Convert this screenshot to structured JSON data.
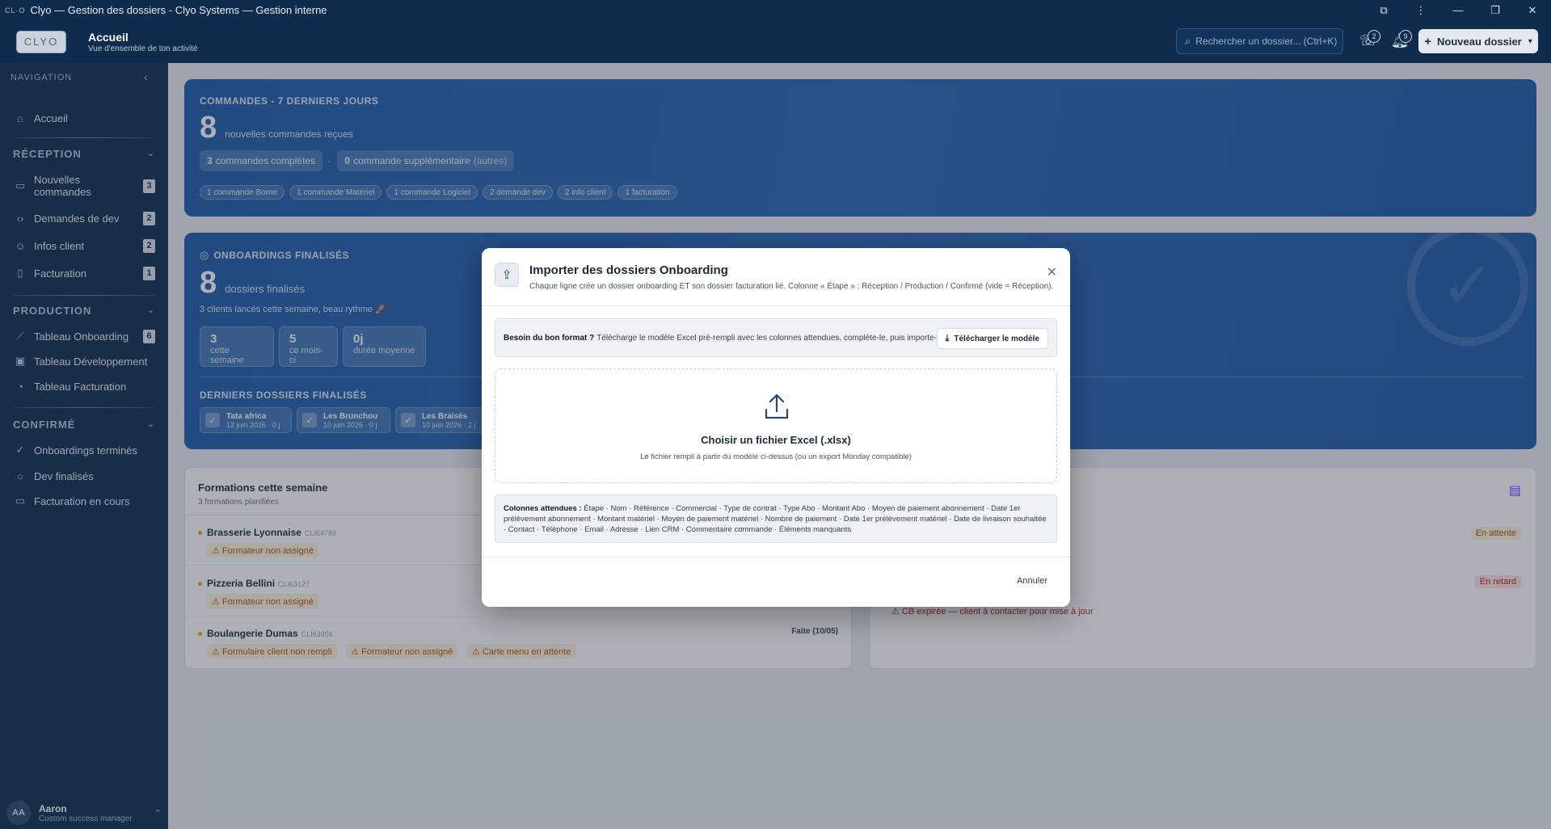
{
  "window": {
    "title": "Clyo — Gestion des dossiers - Clyo Systems — Gestion interne",
    "logo_small": "CL·O"
  },
  "header": {
    "logo": "CLYO",
    "title": "Accueil",
    "subtitle": "Vue d'ensemble de ton activité",
    "search_placeholder": "Rechercher un dossier... (Ctrl+K)",
    "activity_count": "2",
    "notif_count": "9",
    "new_button": "Nouveau dossier"
  },
  "sidebar": {
    "nav_head": "NAVIGATION",
    "home": "Accueil",
    "sections": {
      "reception": "RÉCEPTION",
      "production": "PRODUCTION",
      "confirme": "CONFIRMÉ"
    },
    "reception_items": [
      {
        "label": "Nouvelles commandes",
        "badge": "3"
      },
      {
        "label": "Demandes de dev",
        "badge": "2"
      },
      {
        "label": "Infos client",
        "badge": "2"
      },
      {
        "label": "Facturation",
        "badge": "1"
      }
    ],
    "production_items": [
      {
        "label": "Tableau Onboarding",
        "badge": "6"
      },
      {
        "label": "Tableau Développement"
      },
      {
        "label": "Tableau Facturation"
      }
    ],
    "confirme_items": [
      {
        "label": "Onboardings terminés"
      },
      {
        "label": "Dev finalisés"
      },
      {
        "label": "Facturation en cours"
      }
    ],
    "user": {
      "initials": "AA",
      "name": "Aaron",
      "role": "Custom success manager"
    }
  },
  "commandes": {
    "kicker": "COMMANDES - 7 DERNIERS JOURS",
    "count": "8",
    "count_label": "nouvelles commandes reçues",
    "pill1_num": "3",
    "pill1_label": "commandes complètes",
    "sep": "·",
    "pill2_num": "0",
    "pill2_label": "commande supplémentaire",
    "pill2_extra": "(autres)",
    "chips": [
      "1 commande Borne",
      "1 commande Matériel",
      "1 commande Logiciel",
      "2 demande dev",
      "2 info client",
      "1 facturation"
    ]
  },
  "onboardings": {
    "kicker": "ONBOARDINGS FINALISÉS",
    "count": "8",
    "count_label": "dossiers finalisés",
    "rhythm": "3 clients lancés cette semaine, beau rythme 🚀",
    "stats": [
      {
        "num": "3",
        "label": "cette semaine"
      },
      {
        "num": "5",
        "label": "ce mois-ci"
      },
      {
        "num": "0j",
        "label": "durée moyenne"
      }
    ],
    "recent_head": "DERNIERS DOSSIERS FINALISÉS",
    "recent": [
      {
        "name": "Tata africa",
        "date": "12 juin 2026 · 0 j"
      },
      {
        "name": "Les Brunchou",
        "date": "10 juin 2026 · 0 j"
      },
      {
        "name": "Les Braisés",
        "date": "10 juin 2026 · 2 j"
      }
    ]
  },
  "formations": {
    "title": "Formations cette semaine",
    "subtitle": "3 formations planifiées",
    "rows": [
      {
        "name": "Brasserie Lyonnaise",
        "code": "CLI64789",
        "warnings": [
          "⚠ Formateur non assigné"
        ],
        "status": ""
      },
      {
        "name": "Pizzeria Bellini",
        "code": "CLI63127",
        "warnings": [
          "⚠ Formateur non assigné"
        ],
        "status": ""
      },
      {
        "name": "Boulangerie Dumas",
        "code": "CLI63856",
        "warnings": [
          "⚠ Formulaire client non rempli",
          "⚠ Formateur non assigné",
          "⚠ Carte menu en attente"
        ],
        "status": "Faite (10/05)"
      }
    ]
  },
  "facturation_card": {
    "status1": "En attente",
    "status2": "En retard",
    "alert": "⚠ CB expirée — client à contacter pour mise à jour"
  },
  "modal": {
    "title": "Importer des dossiers Onboarding",
    "subtitle": "Chaque ligne crée un dossier onboarding ET son dossier facturation lié. Colonne « Étape » : Réception / Production / Confirmé (vide = Réception).",
    "help_bold": "Besoin du bon format ?",
    "help_text": "Télécharge le modèle Excel pré-rempli avec les colonnes attendues, complète-le, puis importe-le.",
    "download_button": "Télécharger le modèle",
    "drop_title": "Choisir un fichier Excel (.xlsx)",
    "drop_sub": "Le fichier rempli à partir du modèle ci-dessus (ou un export Monday compatible)",
    "cols_bold": "Colonnes attendues :",
    "cols_text": "Étape · Nom · Référence · Commercial · Type de contrat · Type Abo · Montant Abo · Moyen de paiement abonnement · Date 1er prélèvement abonnement · Montant matériel · Moyen de paiement matériel · Nombre de paiement · Date 1er prélèvement matériel · Date de livraison souhaitée · Contact · Téléphone · Email · Adresse · Lien CRM · Commentaire commande · Éléments manquants",
    "cancel": "Annuler"
  }
}
